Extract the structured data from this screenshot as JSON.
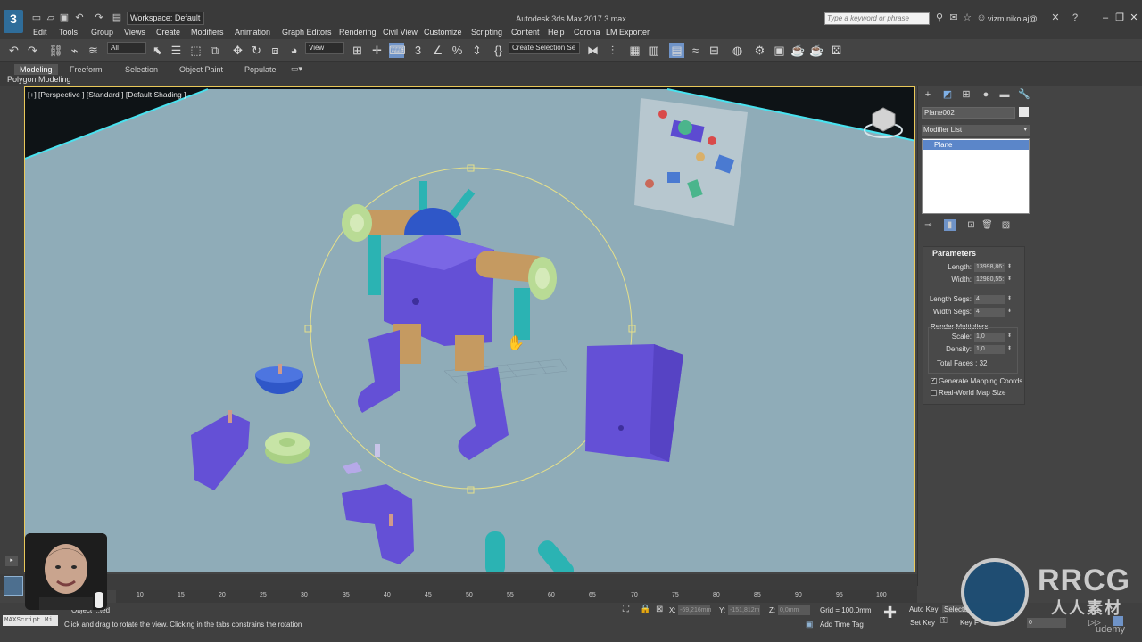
{
  "titlebar": {
    "logo": "3",
    "workspace": "Workspace: Default",
    "app_title": "Autodesk 3ds Max 2017     3.max",
    "search_placeholder": "Type a keyword or phrase",
    "user": "vizm.nikolaj@...",
    "icons": [
      "new-icon",
      "open-icon",
      "save-icon",
      "undo-icon",
      "redo-icon",
      "binoculars-icon",
      "star-icon",
      "user-icon",
      "help-icon",
      "minimize-icon",
      "restore-icon",
      "close-icon"
    ]
  },
  "menu": [
    "Edit",
    "Tools",
    "Group",
    "Views",
    "Create",
    "Modifiers",
    "Animation",
    "Graph Editors",
    "Rendering",
    "Civil View",
    "Customize",
    "Scripting",
    "Content",
    "Help",
    "Corona",
    "LM Exporter"
  ],
  "toolbar": {
    "filter": "All",
    "ref_coord": "View",
    "selection_set": "Create Selection Se"
  },
  "ribbon": {
    "tabs": [
      "Modeling",
      "Freeform",
      "Selection",
      "Object Paint",
      "Populate"
    ],
    "panel_label": "Polygon Modeling"
  },
  "viewport": {
    "label": "[+] [Perspective ] [Standard ] [Default Shading ]",
    "background": "#8facb8"
  },
  "command_panel": {
    "object_name": "Plane002",
    "modifier_list": "Modifier List",
    "stack_item": "Plane",
    "parameters": {
      "title": "Parameters",
      "length_label": "Length:",
      "length": "13998,86:",
      "width_label": "Width:",
      "width": "12980,55:",
      "length_segs_label": "Length Segs:",
      "length_segs": "4",
      "width_segs_label": "Width Segs:",
      "width_segs": "4",
      "render_multipliers": "Render Multipliers",
      "scale_label": "Scale:",
      "scale": "1,0",
      "density_label": "Density:",
      "density": "1,0",
      "total_faces": "Total Faces : 32",
      "gen_mapping": "Generate Mapping Coords.",
      "gen_mapping_checked": true,
      "real_world": "Real-World Map Size",
      "real_world_checked": false
    }
  },
  "timeline": {
    "ticks": [
      "10",
      "15",
      "20",
      "25",
      "30",
      "35",
      "40",
      "45",
      "50",
      "55",
      "60",
      "65",
      "70",
      "75",
      "80",
      "85",
      "90",
      "95",
      "100"
    ]
  },
  "status": {
    "maxscript": "MAXScript Mi",
    "line1": "Object ...ted",
    "line2": "Click and drag to rotate the view.  Clicking in the tabs constrains the rotation",
    "x_label": "X:",
    "x_value": "-69,216mm",
    "y_label": "Y:",
    "y_value": "-151,812m",
    "z_label": "Z:",
    "z_value": "0,0mm",
    "grid": "Grid = 100,0mm",
    "add_time_tag": "Add Time Tag",
    "auto_key": "Auto Key",
    "set_key": "Set Key",
    "selected": "Selecte",
    "key_filters": "Key F",
    "frame": "0"
  },
  "watermark": {
    "brand": "RRCG",
    "brand_cn": "人人素材",
    "udemy": "udemy"
  }
}
